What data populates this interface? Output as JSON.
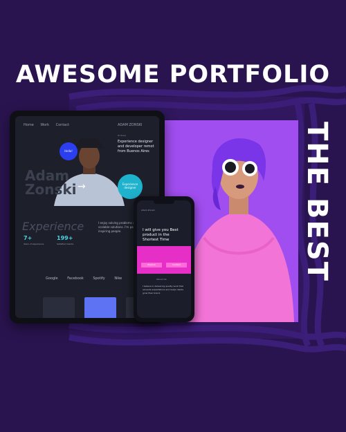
{
  "headline": "AWESOME PORTFOLIO",
  "vertical_tagline": "THE BEST",
  "colors": {
    "background": "#2a1450",
    "stripe": "#3b1e78",
    "panel": "#a14ef0",
    "accent_pink": "#e62fc7",
    "accent_teal": "#1fb2cc",
    "accent_blue": "#2b3ff0"
  },
  "tablet": {
    "nav": [
      "Home",
      "Work",
      "Contact"
    ],
    "brand": "ADAM ZONSKI",
    "small_label": "Hi there",
    "headline": "Experience designer and developer remot from Buenos Aires",
    "name_line_1": "Adam",
    "name_line_2": "Zonski",
    "bubble_blue": "Hello!",
    "bubble_teal": "Experience designer",
    "mid_script": "Experience",
    "mid_text": "I enjoy solving problems and creating scalable solutions. I'm passionate for inspiring people.",
    "stats": [
      {
        "value": "7+",
        "label": "Years of experience"
      },
      {
        "value": "199+",
        "label": "Satisfied Clients"
      }
    ],
    "logos": [
      "Google",
      "Facebook",
      "Spotify",
      "Nike"
    ]
  },
  "phone": {
    "top_label": "Adam Zonski",
    "headline": "I will give you Best product in the Shortest Time",
    "band_buttons": [
      "Explore",
      "Contact"
    ],
    "mid_label": "About me",
    "text": "I believe in delivering quality work that exceeds expectations and helps clients grow their brand."
  }
}
